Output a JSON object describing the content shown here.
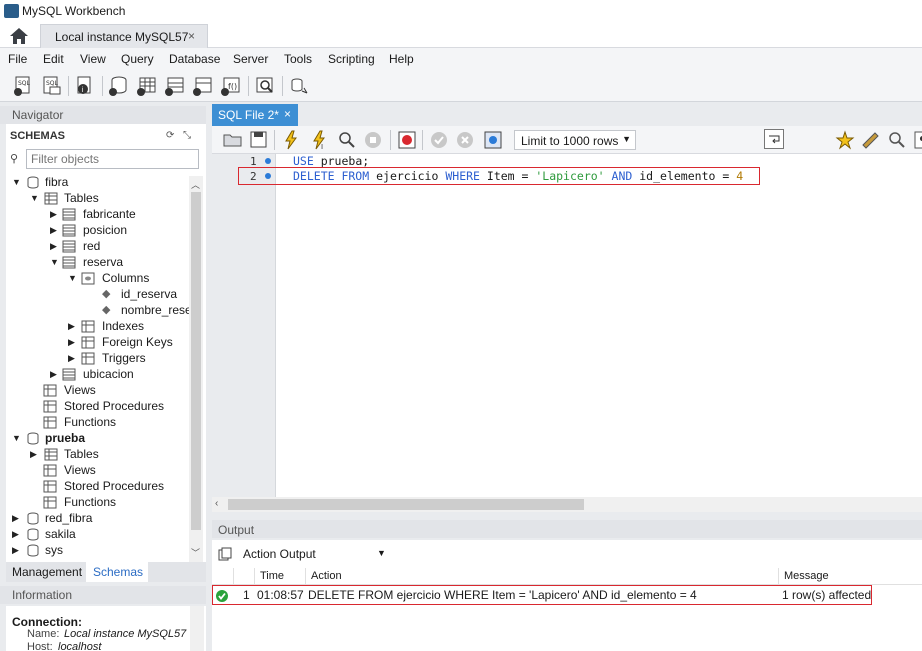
{
  "app": {
    "title": "MySQL Workbench"
  },
  "connection_tab": {
    "label": "Local instance MySQL57",
    "close": "×"
  },
  "menu": [
    "File",
    "Edit",
    "View",
    "Query",
    "Database",
    "Server",
    "Tools",
    "Scripting",
    "Help"
  ],
  "navigator": {
    "header": "Navigator",
    "schemas_label": "SCHEMAS",
    "filter_placeholder": "Filter objects",
    "tree": {
      "fibra": "fibra",
      "tables": "Tables",
      "fabricante": "fabricante",
      "posicion": "posicion",
      "red": "red",
      "reserva": "reserva",
      "columns": "Columns",
      "id_reserva": "id_reserva",
      "nombre_rese": "nombre_rese",
      "indexes": "Indexes",
      "foreign_keys": "Foreign Keys",
      "triggers": "Triggers",
      "ubicacion": "ubicacion",
      "views": "Views",
      "stored_procedures": "Stored Procedures",
      "functions": "Functions",
      "prueba": "prueba",
      "prueba_tables": "Tables",
      "prueba_views": "Views",
      "prueba_stored_procedures": "Stored Procedures",
      "prueba_functions": "Functions",
      "red_fibra": "red_fibra",
      "sakila": "sakila",
      "sys": "sys"
    },
    "bottom_tabs": {
      "management": "Management",
      "schemas": "Schemas"
    }
  },
  "information": {
    "header": "Information",
    "connection_label": "Connection:",
    "name_label": "Name:",
    "name_value": "Local instance MySQL57",
    "host_label": "Host:",
    "host_value": "localhost"
  },
  "editor": {
    "tab_label": "SQL File 2*",
    "limit_label": "Limit to 1000 rows",
    "lines": [
      {
        "num": "1",
        "parts": {
          "kw1": "USE",
          "rest": " prueba;"
        }
      },
      {
        "num": "2",
        "parts": {
          "kw1": "DELETE FROM",
          "t1": " ejercicio ",
          "kw2": "WHERE",
          "t2": " Item = ",
          "str": "'Lapicero'",
          "t3": " ",
          "kw3": "AND",
          "t4": " id_elemento = ",
          "num": "4"
        }
      }
    ]
  },
  "output": {
    "header": "Output",
    "selector": "Action Output",
    "columns": {
      "time": "Time",
      "action": "Action",
      "message": "Message"
    },
    "rows": [
      {
        "index": "1",
        "time": "01:08:57",
        "action": "DELETE FROM ejercicio WHERE Item = 'Lapicero' AND id_elemento = 4",
        "message": "1 row(s) affected"
      }
    ]
  },
  "colors": {
    "accent": "#3d8fd4",
    "highlight_border": "#d9282f",
    "keyword": "#2d5fd0",
    "string": "#2e9a3c",
    "number": "#b07800",
    "ok": "#2aa33b"
  }
}
